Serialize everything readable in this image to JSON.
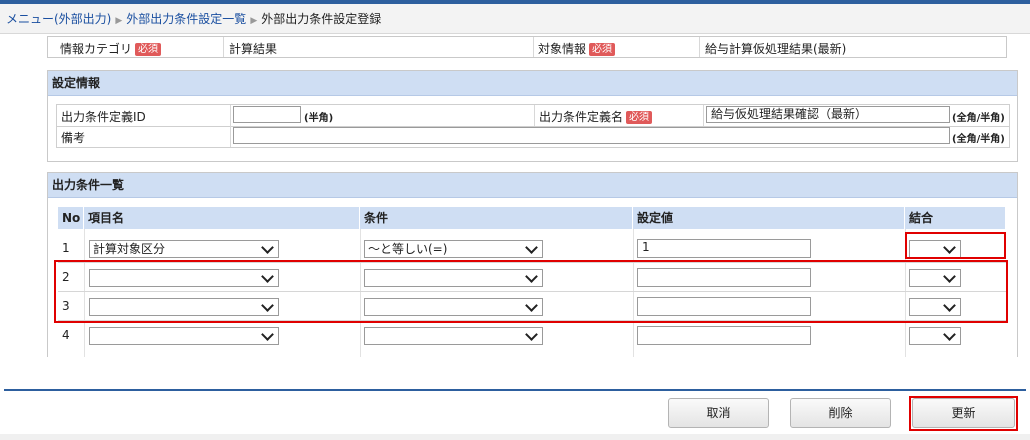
{
  "breadcrumb": {
    "items": [
      "メニュー(外部出力)",
      "外部出力条件設定一覧",
      "外部出力条件設定登録"
    ]
  },
  "header_info": {
    "category_label": "情報カテゴリ",
    "category_value": "計算結果",
    "target_label": "対象情報",
    "target_value": "給与計算仮処理結果(最新)",
    "required_badge": "必須"
  },
  "settings": {
    "title": "設定情報",
    "id_label": "出力条件定義ID",
    "id_value": "",
    "id_note": "(半角)",
    "name_label": "出力条件定義名",
    "name_value": "給与仮処理結果確認（最新）",
    "name_note": "(全角/半角)",
    "remarks_label": "備考",
    "remarks_value": "",
    "remarks_note": "(全角/半角)"
  },
  "conditions": {
    "title": "出力条件一覧",
    "columns": [
      "No",
      "項目名",
      "条件",
      "設定値",
      "結合"
    ],
    "rows": [
      {
        "no": "1",
        "item": "計算対象区分",
        "cond": "～と等しい(=)",
        "value": "1",
        "join": ""
      },
      {
        "no": "2",
        "item": "",
        "cond": "",
        "value": "",
        "join": ""
      },
      {
        "no": "3",
        "item": "",
        "cond": "",
        "value": "",
        "join": ""
      },
      {
        "no": "4",
        "item": "",
        "cond": "",
        "value": "",
        "join": ""
      }
    ]
  },
  "buttons": {
    "cancel": "取消",
    "delete": "削除",
    "update": "更新"
  },
  "colors": {
    "accent": "#2d5f9e",
    "header_bg": "#cfdef3",
    "required": "#e05a5a",
    "highlight": "#e00000"
  }
}
